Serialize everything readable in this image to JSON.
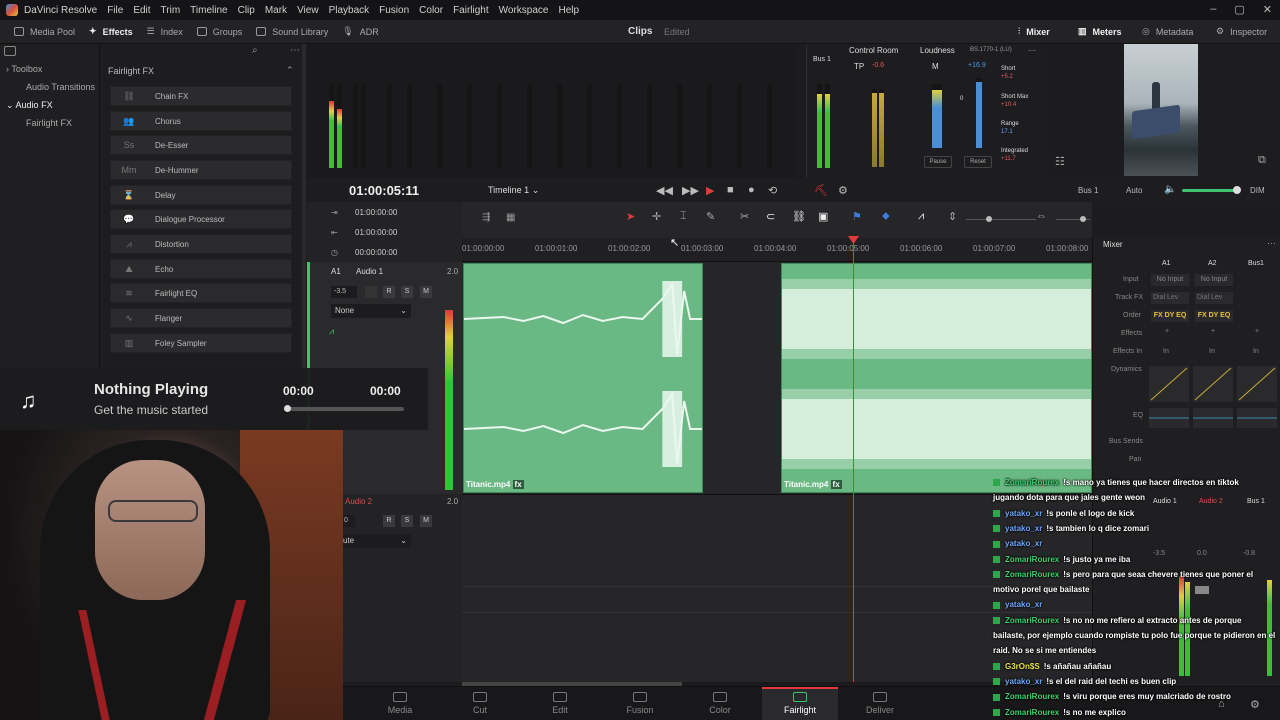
{
  "app": {
    "name": "DaVinci Resolve",
    "menu": [
      "File",
      "Edit",
      "Trim",
      "Timeline",
      "Clip",
      "Mark",
      "View",
      "Playback",
      "Fusion",
      "Color",
      "Fairlight",
      "Workspace",
      "Help"
    ]
  },
  "toolbar": {
    "left": [
      "Media Pool",
      "Effects",
      "Index",
      "Groups",
      "Sound Library",
      "ADR"
    ],
    "active": "Effects",
    "center_title": "Clips",
    "center_status": "Edited",
    "right": [
      "Mixer",
      "Meters",
      "Metadata",
      "Inspector"
    ]
  },
  "left_panel": {
    "tree": [
      "Toolbox",
      "Audio Transitions",
      "Audio FX",
      "Fairlight FX"
    ],
    "selected": "Audio FX"
  },
  "fx_panel": {
    "header": "Fairlight FX",
    "items": [
      "Chain FX",
      "Chorus",
      "De-Esser",
      "De-Hummer",
      "Delay",
      "Dialogue Processor",
      "Distortion",
      "Echo",
      "Fairlight EQ",
      "Flanger",
      "Foley Sampler"
    ]
  },
  "monitor": {
    "bus_label": "Bus 1",
    "control_room": "Control Room",
    "loudness": "Loudness",
    "standard": "BS.1770-1 (LU)",
    "tp_label": "TP",
    "tp_value": "-0.6",
    "m_label": "M",
    "m_value": "+16.9",
    "short_label": "Short",
    "short_value": "+5.2",
    "short_max_label": "Short Max",
    "short_max_value": "+10.4",
    "range_label": "Range",
    "range_value": "17.1",
    "integrated_label": "Integrated",
    "integrated_value": "+11.7",
    "pause": "Pause",
    "reset": "Reset"
  },
  "timeline": {
    "timecode": "01:00:05:11",
    "name": "Timeline 1",
    "tc_rows": [
      "01:00:00:00",
      "01:00:00:00",
      "00:00:00:00"
    ],
    "right_labels": [
      "Bus 1",
      "Auto",
      "DIM"
    ],
    "ruler": [
      "01:00:00:00",
      "01:00:01:00",
      "01:00:02:00",
      "01:00:03:00",
      "01:00:04:00",
      "01:00:05:00",
      "01:00:06:00",
      "01:00:07:00",
      "01:00:08:00"
    ],
    "track1": {
      "id": "A1",
      "name": "Audio 1",
      "ch": "2.0",
      "volume": "-3.5",
      "fx": "None"
    },
    "track2": {
      "name": "Audio 2",
      "ch": "2.0",
      "volume": "0",
      "fx": "ute"
    },
    "clips": [
      "Titanic.mp4",
      "Titanic.mp4"
    ]
  },
  "mixer": {
    "title": "Mixer",
    "channels": [
      "A1",
      "A2",
      "Bus1"
    ],
    "rows": [
      "Input",
      "Track FX",
      "Order",
      "Effects",
      "Effects In",
      "Dynamics",
      "EQ",
      "Bus Sends",
      "Pan"
    ],
    "input_values": [
      "No Input",
      "No Input"
    ],
    "track_fx": [
      "Dial Lev",
      "Dial Lev"
    ],
    "order": [
      "FX DY EQ",
      "FX DY EQ"
    ],
    "in_label": "In",
    "bottom_names": [
      "Audio 1",
      "Audio 2",
      "Bus 1"
    ],
    "bottom_values": [
      "-3.5",
      "0.0",
      "-0.8"
    ]
  },
  "page_tabs": [
    "Media",
    "Cut",
    "Edit",
    "Fusion",
    "Color",
    "Fairlight",
    "Deliver"
  ],
  "active_page": "Fairlight",
  "music": {
    "title": "Nothing Playing",
    "subtitle": "Get the music started",
    "elapsed": "00:00",
    "duration": "00:00",
    "progress": 0
  },
  "chat": [
    {
      "user": "ZomariRourex",
      "color": "#3ad16b",
      "text": "!s mano ya tienes que hacer directos en tiktok"
    },
    {
      "user": "",
      "color": "#ffffff",
      "text": "jugando dota para que jales gente weon"
    },
    {
      "user": "yatako_xr",
      "color": "#6aa7ff",
      "text": "!s ponle el logo de kick"
    },
    {
      "user": "yatako_xr",
      "color": "#6aa7ff",
      "text": "!s tambien lo q dice zomari"
    },
    {
      "user": "yatako_xr",
      "color": "#6aa7ff",
      "text": ""
    },
    {
      "user": "ZomariRourex",
      "color": "#3ad16b",
      "text": "!s justo ya me iba"
    },
    {
      "user": "ZomariRourex",
      "color": "#3ad16b",
      "text": "!s pero para que seaa chevere tienes que poner el"
    },
    {
      "user": "",
      "color": "#ffffff",
      "text": "motivo porel que bailaste"
    },
    {
      "user": "yatako_xr",
      "color": "#6aa7ff",
      "text": ""
    },
    {
      "user": "ZomariRourex",
      "color": "#3ad16b",
      "text": "!s no no me refiero al extracto antes de porque"
    },
    {
      "user": "",
      "color": "#ffffff",
      "text": "bailaste, por ejemplo cuando rompiste tu polo fue porque te pidieron en el"
    },
    {
      "user": "",
      "color": "#ffffff",
      "text": "raid. No se si me entiendes"
    },
    {
      "user": "G3rOn$S",
      "color": "#e6e24a",
      "text": "!s añañau añañau"
    },
    {
      "user": "yatako_xr",
      "color": "#6aa7ff",
      "text": "!s el del raid del techi es buen clip"
    },
    {
      "user": "ZomariRourex",
      "color": "#3ad16b",
      "text": "!s viru porque eres muy malcriado de rostro"
    },
    {
      "user": "ZomariRourex",
      "color": "#3ad16b",
      "text": "!s no me explico"
    },
    {
      "user": "G3rOn$S",
      "color": "#e6e24a",
      "text": ""
    }
  ]
}
